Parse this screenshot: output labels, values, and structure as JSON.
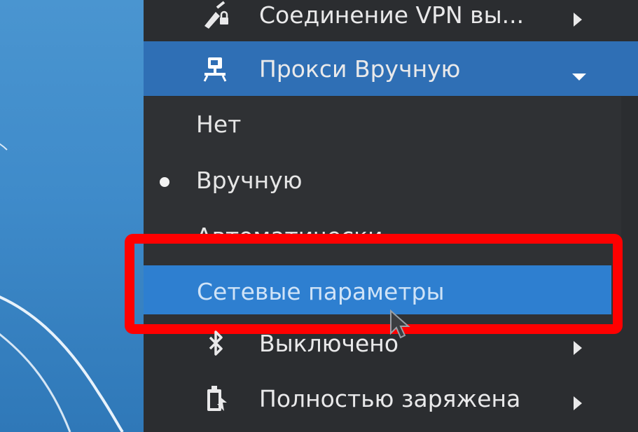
{
  "desktop": {
    "background": "#4690cd"
  },
  "menu": {
    "vpn": {
      "label": "Соединение VPN вы...",
      "icon": "vpn-lock-icon"
    },
    "proxy": {
      "label": "Прокси Вручную",
      "icon": "proxy-icon",
      "expanded": true
    },
    "proxy_options": {
      "none": "Нет",
      "manual": "Вручную",
      "auto": "Автоматически",
      "selected": "manual"
    },
    "network_settings": "Сетевые параметры",
    "bluetooth": {
      "label": "Выключено",
      "icon": "bluetooth-icon"
    },
    "battery": {
      "label": "Полностью заряжена",
      "icon": "battery-icon"
    }
  },
  "colors": {
    "highlight": "#2f6fb5",
    "selected_item": "#2e7fd0",
    "annotation": "#ff0000",
    "menu_bg": "#2b2d30"
  }
}
